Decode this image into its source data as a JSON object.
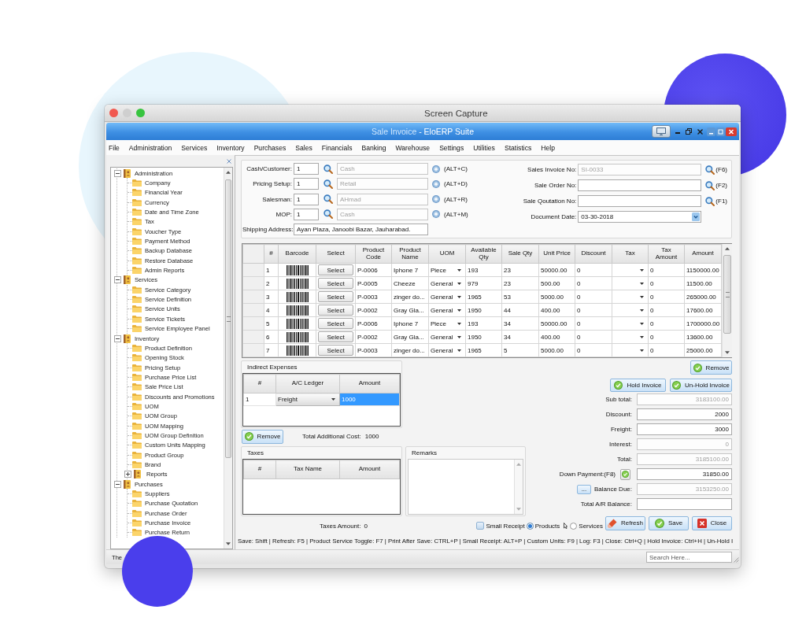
{
  "capture_window": {
    "title": "Screen Capture"
  },
  "app_window": {
    "title_document": "Sale Invoice",
    "title_suite": "- EloERP Suite"
  },
  "menu": [
    "File",
    "Administration",
    "Services",
    "Inventory",
    "Purchases",
    "Sales",
    "Financials",
    "Banking",
    "Warehouse",
    "Settings",
    "Utilities",
    "Statistics",
    "Help"
  ],
  "sidebar": {
    "tree": [
      {
        "kind": "group",
        "label": "Administration",
        "expanded": true,
        "children": [
          {
            "kind": "item",
            "label": "Company"
          },
          {
            "kind": "item",
            "label": "Financial Year"
          },
          {
            "kind": "item",
            "label": "Currency"
          },
          {
            "kind": "item",
            "label": "Date and Time Zone"
          },
          {
            "kind": "item",
            "label": "Tax"
          },
          {
            "kind": "item",
            "label": "Voucher Type"
          },
          {
            "kind": "item",
            "label": "Payment Method"
          },
          {
            "kind": "item",
            "label": "Backup Database"
          },
          {
            "kind": "item",
            "label": "Restore Database"
          },
          {
            "kind": "item",
            "label": "Admin Reports"
          }
        ]
      },
      {
        "kind": "group",
        "label": "Services",
        "expanded": true,
        "children": [
          {
            "kind": "item",
            "label": "Service Category"
          },
          {
            "kind": "item",
            "label": "Service Definition"
          },
          {
            "kind": "item",
            "label": "Service Units"
          },
          {
            "kind": "item",
            "label": "Service Tickets"
          },
          {
            "kind": "item",
            "label": "Service Employee Panel"
          }
        ]
      },
      {
        "kind": "group",
        "label": "Inventory",
        "expanded": true,
        "children": [
          {
            "kind": "item",
            "label": "Product Definition"
          },
          {
            "kind": "item",
            "label": "Opening Stock"
          },
          {
            "kind": "item",
            "label": "Pricing Setup"
          },
          {
            "kind": "item",
            "label": "Purchase Price List"
          },
          {
            "kind": "item",
            "label": "Sale Price List"
          },
          {
            "kind": "item",
            "label": "Discounts and Promotions"
          },
          {
            "kind": "item",
            "label": "UOM"
          },
          {
            "kind": "item",
            "label": "UOM Group"
          },
          {
            "kind": "item",
            "label": "UOM Mapping"
          },
          {
            "kind": "item",
            "label": "UOM Group Definition"
          },
          {
            "kind": "item",
            "label": "Custom Units Mapping"
          },
          {
            "kind": "item",
            "label": "Product Group"
          },
          {
            "kind": "item",
            "label": "Brand"
          },
          {
            "kind": "group",
            "label": "Reports",
            "expanded": false
          }
        ]
      },
      {
        "kind": "group",
        "label": "Purchases",
        "expanded": true,
        "children": [
          {
            "kind": "item",
            "label": "Suppliers"
          },
          {
            "kind": "item",
            "label": "Purchase Quotation"
          },
          {
            "kind": "item",
            "label": "Purchase Order"
          },
          {
            "kind": "item",
            "label": "Purchase Invoice"
          },
          {
            "kind": "item",
            "label": "Purchase Return"
          }
        ]
      }
    ]
  },
  "form": {
    "left_rows": [
      {
        "label": "Cash/Customer:",
        "code": "1",
        "name": "Cash",
        "name_disabled": true,
        "shortcut": "(ALT+C)"
      },
      {
        "label": "Pricing Setup:",
        "code": "1",
        "name": "Retail",
        "name_disabled": true,
        "shortcut": "(ALT+D)"
      },
      {
        "label": "Salesman:",
        "code": "1",
        "name": "AHmad",
        "name_disabled": true,
        "shortcut": "(ALT+R)"
      },
      {
        "label": "MOP:",
        "code": "1",
        "name": "Cash",
        "name_disabled": true,
        "shortcut": "(ALT+M)"
      }
    ],
    "shipping": {
      "label": "Shipping Address:",
      "value": "Ayan Plaza, Janoobi Bazar, Jauharabad."
    },
    "right_rows": [
      {
        "kind": "search",
        "label": "Sales Invoice No:",
        "value": "SI-0033",
        "disabled": true,
        "shortcut": "(F6)"
      },
      {
        "kind": "search",
        "label": "Sale Order No:",
        "disabled": false,
        "shortcut": "(F2)"
      },
      {
        "kind": "search",
        "label": "Sale Qoutation No:",
        "disabled": false,
        "shortcut": "(F1)"
      },
      {
        "kind": "date",
        "label": "Document Date:",
        "value": "03-30-2018"
      }
    ]
  },
  "items_table": {
    "columns": [
      "#",
      "Barcode",
      "Select",
      "Product Code",
      "Product Name",
      "UOM",
      "Available Qty",
      "Sale Qty",
      "Unit Price",
      "Discount",
      "Tax",
      "Tax Amount",
      "Amount"
    ],
    "rows": [
      {
        "number": "1",
        "select": "Select",
        "code": "P-0006",
        "name": "Iphone 7",
        "uom": "Piece",
        "available": "193",
        "sale_qty": "23",
        "unit_price": "50000.00",
        "discount": "0",
        "tax_amount": "0",
        "amount": "1150000.00"
      },
      {
        "number": "2",
        "select": "Select",
        "code": "P-0005",
        "name": "Cheeze",
        "uom": "General",
        "available": "979",
        "sale_qty": "23",
        "unit_price": "500.00",
        "discount": "0",
        "tax_amount": "0",
        "amount": "11500.00"
      },
      {
        "number": "3",
        "select": "Select",
        "code": "P-0003",
        "name": "zinger do...",
        "uom": "General",
        "available": "1965",
        "sale_qty": "53",
        "unit_price": "5000.00",
        "discount": "0",
        "tax_amount": "0",
        "amount": "265000.00"
      },
      {
        "number": "4",
        "select": "Select",
        "code": "P-0002",
        "name": "Gray Gla...",
        "uom": "General",
        "available": "1950",
        "sale_qty": "44",
        "unit_price": "400.00",
        "discount": "0",
        "tax_amount": "0",
        "amount": "17600.00"
      },
      {
        "number": "5",
        "select": "Select",
        "code": "P-0006",
        "name": "Iphone 7",
        "uom": "Piece",
        "available": "193",
        "sale_qty": "34",
        "unit_price": "50000.00",
        "discount": "0",
        "tax_amount": "0",
        "amount": "1700000.00"
      },
      {
        "number": "6",
        "select": "Select",
        "code": "P-0002",
        "name": "Gray Gla...",
        "uom": "General",
        "available": "1950",
        "sale_qty": "34",
        "unit_price": "400.00",
        "discount": "0",
        "tax_amount": "0",
        "amount": "13600.00"
      },
      {
        "number": "7",
        "select": "Select",
        "code": "P-0003",
        "name": "zinger do...",
        "uom": "General",
        "available": "1965",
        "sale_qty": "5",
        "unit_price": "5000.00",
        "discount": "0",
        "tax_amount": "0",
        "amount": "25000.00"
      }
    ]
  },
  "indirect_expenses": {
    "title": "Indirect Expenses",
    "columns": [
      "#",
      "A/C Ledger",
      "Amount"
    ],
    "rows": [
      {
        "number": "1",
        "ledger": "Freight",
        "amount": "1000",
        "selected": true
      }
    ]
  },
  "expense_remove_button": "Remove",
  "total_additional_cost": {
    "label": "Total Additional Cost:",
    "value": "1000"
  },
  "taxes": {
    "title": "Taxes",
    "columns": [
      "#",
      "Tax Name",
      "Amount"
    ]
  },
  "remarks": {
    "title": "Remarks"
  },
  "taxes_amount": {
    "label": "Taxes Amount:",
    "value": "0"
  },
  "item_remove_button": "Remove",
  "hold_buttons": [
    "Hold Invoice",
    "Un-Hold Invoice"
  ],
  "summary": [
    {
      "kind": "plain",
      "label": "Sub total:",
      "value": "3183100.00",
      "disabled": true
    },
    {
      "kind": "plain",
      "label": "Discount:",
      "value": "2000",
      "disabled": false
    },
    {
      "kind": "plain",
      "label": "Freight:",
      "value": "3000",
      "disabled": false
    },
    {
      "kind": "plain",
      "label": "Interest:",
      "value": "0",
      "disabled": true
    },
    {
      "kind": "plain",
      "label": "Total:",
      "value": "3185100.00",
      "disabled": true
    },
    {
      "kind": "check",
      "label": "Down Payment:(F8)",
      "value": "31850.00",
      "disabled": false
    },
    {
      "kind": "more",
      "button_label": "...",
      "label": "Balance Due:",
      "value": "3153250.00",
      "disabled": true
    },
    {
      "kind": "plain",
      "label": "Total A/R Balance:",
      "disabled": false
    }
  ],
  "options": {
    "small_receipt": {
      "label": "Small Receipt",
      "checked": false
    },
    "mode": [
      {
        "label": "Products",
        "selected": true
      },
      {
        "label": "Services",
        "selected": false
      }
    ]
  },
  "actions": [
    {
      "kind": "refresh",
      "label": "Refresh"
    },
    {
      "kind": "save",
      "label": "Save"
    },
    {
      "kind": "close",
      "label": "Close"
    }
  ],
  "shortcut_hints": "Save: Shift | Refresh: F5 | Product Service Toggle: F7 | Print After Save: CTRL+P | Small Receipt: ALT+P | Custom Units: F9 | Log: F3 | Close: Ctrl+Q | Hold Invoice: Ctrl+H | Un-Hold I",
  "status_text": "The",
  "search": {
    "placeholder": "Search Here..."
  }
}
